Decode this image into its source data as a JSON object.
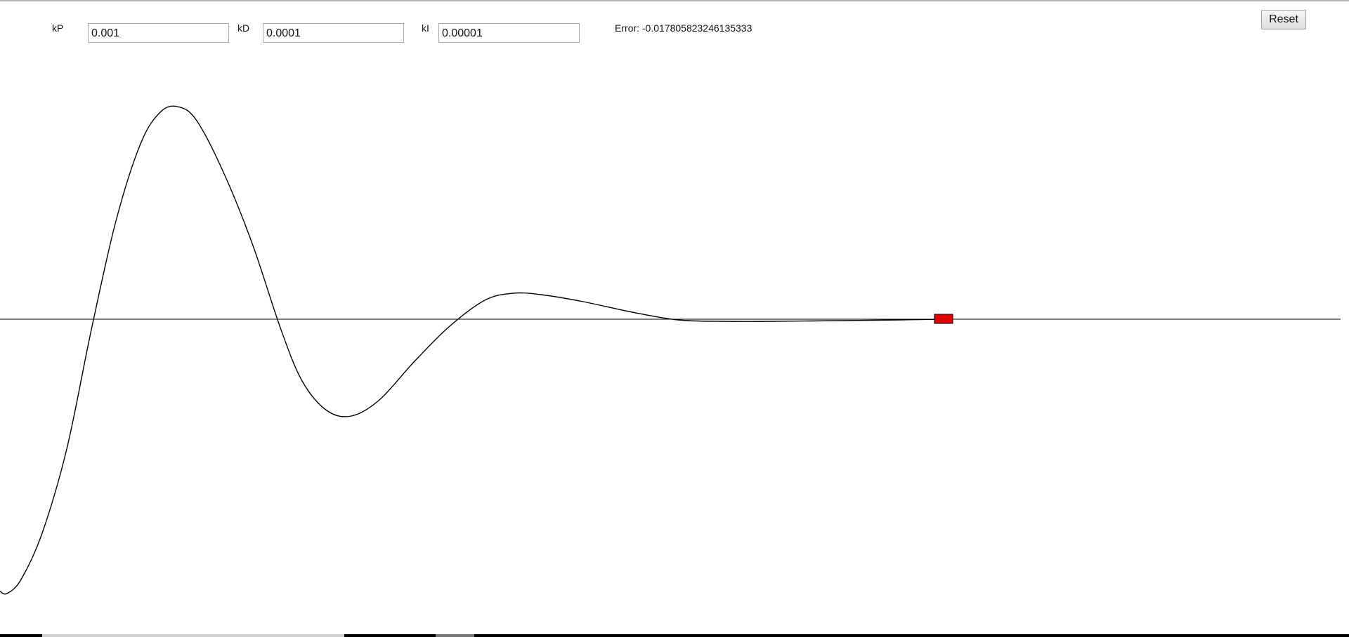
{
  "controls": {
    "kp": {
      "label": "kP",
      "value": "0.001"
    },
    "kd": {
      "label": "kD",
      "value": "0.0001"
    },
    "ki": {
      "label": "kI",
      "value": "0.00001"
    }
  },
  "error": {
    "label": "Error:",
    "value": "-0.017805823246135333"
  },
  "reset_label": "Reset",
  "colors": {
    "curve": "#000000",
    "axis": "#000000",
    "cart_fill": "#e00000",
    "cart_border": "#000000"
  }
}
